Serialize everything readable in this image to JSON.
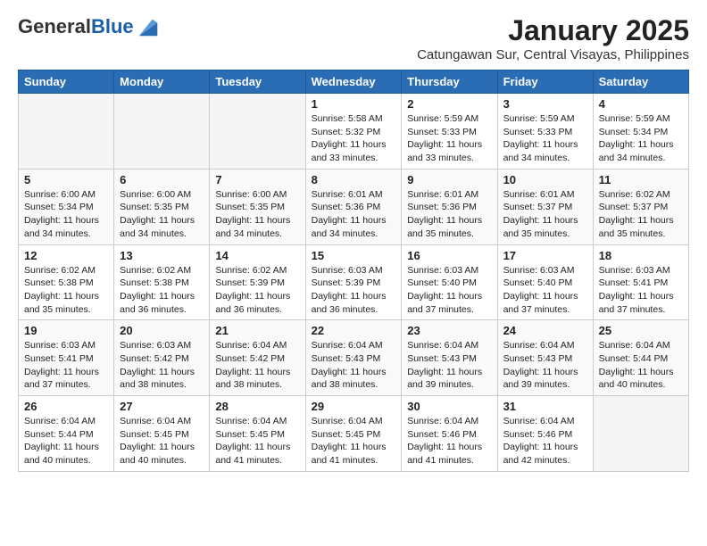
{
  "logo": {
    "general": "General",
    "blue": "Blue"
  },
  "header": {
    "title": "January 2025",
    "subtitle": "Catungawan Sur, Central Visayas, Philippines"
  },
  "weekdays": [
    "Sunday",
    "Monday",
    "Tuesday",
    "Wednesday",
    "Thursday",
    "Friday",
    "Saturday"
  ],
  "weeks": [
    [
      {
        "day": "",
        "sunrise": "",
        "sunset": "",
        "daylight": ""
      },
      {
        "day": "",
        "sunrise": "",
        "sunset": "",
        "daylight": ""
      },
      {
        "day": "",
        "sunrise": "",
        "sunset": "",
        "daylight": ""
      },
      {
        "day": "1",
        "sunrise": "Sunrise: 5:58 AM",
        "sunset": "Sunset: 5:32 PM",
        "daylight": "Daylight: 11 hours and 33 minutes."
      },
      {
        "day": "2",
        "sunrise": "Sunrise: 5:59 AM",
        "sunset": "Sunset: 5:33 PM",
        "daylight": "Daylight: 11 hours and 33 minutes."
      },
      {
        "day": "3",
        "sunrise": "Sunrise: 5:59 AM",
        "sunset": "Sunset: 5:33 PM",
        "daylight": "Daylight: 11 hours and 34 minutes."
      },
      {
        "day": "4",
        "sunrise": "Sunrise: 5:59 AM",
        "sunset": "Sunset: 5:34 PM",
        "daylight": "Daylight: 11 hours and 34 minutes."
      }
    ],
    [
      {
        "day": "5",
        "sunrise": "Sunrise: 6:00 AM",
        "sunset": "Sunset: 5:34 PM",
        "daylight": "Daylight: 11 hours and 34 minutes."
      },
      {
        "day": "6",
        "sunrise": "Sunrise: 6:00 AM",
        "sunset": "Sunset: 5:35 PM",
        "daylight": "Daylight: 11 hours and 34 minutes."
      },
      {
        "day": "7",
        "sunrise": "Sunrise: 6:00 AM",
        "sunset": "Sunset: 5:35 PM",
        "daylight": "Daylight: 11 hours and 34 minutes."
      },
      {
        "day": "8",
        "sunrise": "Sunrise: 6:01 AM",
        "sunset": "Sunset: 5:36 PM",
        "daylight": "Daylight: 11 hours and 34 minutes."
      },
      {
        "day": "9",
        "sunrise": "Sunrise: 6:01 AM",
        "sunset": "Sunset: 5:36 PM",
        "daylight": "Daylight: 11 hours and 35 minutes."
      },
      {
        "day": "10",
        "sunrise": "Sunrise: 6:01 AM",
        "sunset": "Sunset: 5:37 PM",
        "daylight": "Daylight: 11 hours and 35 minutes."
      },
      {
        "day": "11",
        "sunrise": "Sunrise: 6:02 AM",
        "sunset": "Sunset: 5:37 PM",
        "daylight": "Daylight: 11 hours and 35 minutes."
      }
    ],
    [
      {
        "day": "12",
        "sunrise": "Sunrise: 6:02 AM",
        "sunset": "Sunset: 5:38 PM",
        "daylight": "Daylight: 11 hours and 35 minutes."
      },
      {
        "day": "13",
        "sunrise": "Sunrise: 6:02 AM",
        "sunset": "Sunset: 5:38 PM",
        "daylight": "Daylight: 11 hours and 36 minutes."
      },
      {
        "day": "14",
        "sunrise": "Sunrise: 6:02 AM",
        "sunset": "Sunset: 5:39 PM",
        "daylight": "Daylight: 11 hours and 36 minutes."
      },
      {
        "day": "15",
        "sunrise": "Sunrise: 6:03 AM",
        "sunset": "Sunset: 5:39 PM",
        "daylight": "Daylight: 11 hours and 36 minutes."
      },
      {
        "day": "16",
        "sunrise": "Sunrise: 6:03 AM",
        "sunset": "Sunset: 5:40 PM",
        "daylight": "Daylight: 11 hours and 37 minutes."
      },
      {
        "day": "17",
        "sunrise": "Sunrise: 6:03 AM",
        "sunset": "Sunset: 5:40 PM",
        "daylight": "Daylight: 11 hours and 37 minutes."
      },
      {
        "day": "18",
        "sunrise": "Sunrise: 6:03 AM",
        "sunset": "Sunset: 5:41 PM",
        "daylight": "Daylight: 11 hours and 37 minutes."
      }
    ],
    [
      {
        "day": "19",
        "sunrise": "Sunrise: 6:03 AM",
        "sunset": "Sunset: 5:41 PM",
        "daylight": "Daylight: 11 hours and 37 minutes."
      },
      {
        "day": "20",
        "sunrise": "Sunrise: 6:03 AM",
        "sunset": "Sunset: 5:42 PM",
        "daylight": "Daylight: 11 hours and 38 minutes."
      },
      {
        "day": "21",
        "sunrise": "Sunrise: 6:04 AM",
        "sunset": "Sunset: 5:42 PM",
        "daylight": "Daylight: 11 hours and 38 minutes."
      },
      {
        "day": "22",
        "sunrise": "Sunrise: 6:04 AM",
        "sunset": "Sunset: 5:43 PM",
        "daylight": "Daylight: 11 hours and 38 minutes."
      },
      {
        "day": "23",
        "sunrise": "Sunrise: 6:04 AM",
        "sunset": "Sunset: 5:43 PM",
        "daylight": "Daylight: 11 hours and 39 minutes."
      },
      {
        "day": "24",
        "sunrise": "Sunrise: 6:04 AM",
        "sunset": "Sunset: 5:43 PM",
        "daylight": "Daylight: 11 hours and 39 minutes."
      },
      {
        "day": "25",
        "sunrise": "Sunrise: 6:04 AM",
        "sunset": "Sunset: 5:44 PM",
        "daylight": "Daylight: 11 hours and 40 minutes."
      }
    ],
    [
      {
        "day": "26",
        "sunrise": "Sunrise: 6:04 AM",
        "sunset": "Sunset: 5:44 PM",
        "daylight": "Daylight: 11 hours and 40 minutes."
      },
      {
        "day": "27",
        "sunrise": "Sunrise: 6:04 AM",
        "sunset": "Sunset: 5:45 PM",
        "daylight": "Daylight: 11 hours and 40 minutes."
      },
      {
        "day": "28",
        "sunrise": "Sunrise: 6:04 AM",
        "sunset": "Sunset: 5:45 PM",
        "daylight": "Daylight: 11 hours and 41 minutes."
      },
      {
        "day": "29",
        "sunrise": "Sunrise: 6:04 AM",
        "sunset": "Sunset: 5:45 PM",
        "daylight": "Daylight: 11 hours and 41 minutes."
      },
      {
        "day": "30",
        "sunrise": "Sunrise: 6:04 AM",
        "sunset": "Sunset: 5:46 PM",
        "daylight": "Daylight: 11 hours and 41 minutes."
      },
      {
        "day": "31",
        "sunrise": "Sunrise: 6:04 AM",
        "sunset": "Sunset: 5:46 PM",
        "daylight": "Daylight: 11 hours and 42 minutes."
      },
      {
        "day": "",
        "sunrise": "",
        "sunset": "",
        "daylight": ""
      }
    ]
  ]
}
